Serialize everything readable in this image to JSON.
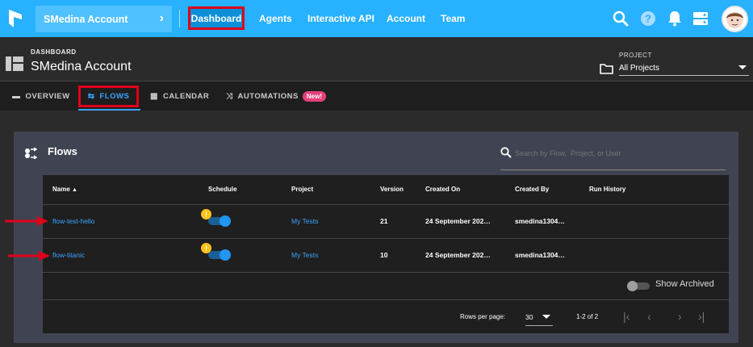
{
  "topbar": {
    "account_name": "SMedina Account",
    "nav": [
      "Dashboard",
      "Agents",
      "Interactive API",
      "Account",
      "Team"
    ]
  },
  "header": {
    "section_label": "DASHBOARD",
    "title": "SMedina Account",
    "project_label": "PROJECT",
    "project_value": "All Projects"
  },
  "tabs": [
    {
      "label": "OVERVIEW",
      "icon": "overview-icon"
    },
    {
      "label": "FLOWS",
      "icon": "flows-icon"
    },
    {
      "label": "CALENDAR",
      "icon": "calendar-icon"
    },
    {
      "label": "AUTOMATIONS",
      "icon": "automations-icon",
      "badge": "New!"
    }
  ],
  "flows_panel": {
    "title": "Flows",
    "search_placeholder": "Search by Flow,  Project, or User",
    "columns": [
      "Name",
      "Schedule",
      "Project",
      "Version",
      "Created On",
      "Created By",
      "Run History"
    ],
    "sort_indicator": "▲",
    "rows": [
      {
        "name": "flow-test-hello",
        "project": "My Tests",
        "version": "21",
        "created_on": "24 September 202…",
        "created_by": "smedina1304…",
        "schedule_on": true
      },
      {
        "name": "flow-titanic",
        "project": "My Tests",
        "version": "10",
        "created_on": "24 September 202…",
        "created_by": "smedina1304…",
        "schedule_on": true
      }
    ],
    "show_archived_label": "Show Archived",
    "rows_per_page_label": "Rows per page:",
    "rows_per_page_value": "30",
    "range_label": "1-2 of 2"
  },
  "colors": {
    "topbar": "#27b1ff",
    "accent_blue": "#3aa4ff",
    "highlight_red": "#e0001b",
    "badge_pink": "#e3417b",
    "warning": "#ffc21a"
  }
}
